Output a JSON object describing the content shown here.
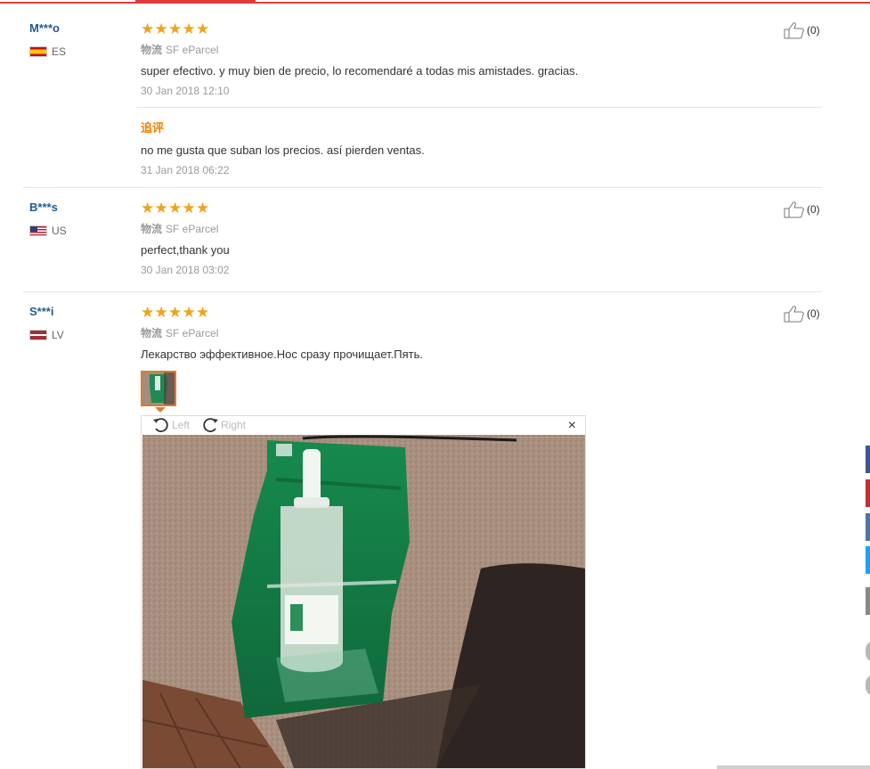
{
  "reviews": [
    {
      "user": "M***o",
      "country": "ES",
      "stars": [
        "★",
        "★",
        "★",
        "★",
        "★"
      ],
      "ship_label": "物流",
      "ship_method": "SF eParcel",
      "text": "super efectivo. y muy bien de precio, lo recomendaré a todas mis amistades. gracias.",
      "date": "30 Jan 2018 12:10",
      "like_count": "(0)",
      "followup": {
        "title": "追评",
        "text": "no me gusta que suban los precios. así pierden ventas.",
        "date": "31 Jan 2018 06:22"
      }
    },
    {
      "user": "B***s",
      "country": "US",
      "stars": [
        "★",
        "★",
        "★",
        "★",
        "★"
      ],
      "ship_label": "物流",
      "ship_method": "SF eParcel",
      "text": "perfect,thank you",
      "date": "30 Jan 2018 03:02",
      "like_count": "(0)"
    },
    {
      "user": "S***i",
      "country": "LV",
      "stars": [
        "★",
        "★",
        "★",
        "★",
        "★"
      ],
      "ship_label": "物流",
      "ship_method": "SF eParcel",
      "text": "Лекарство эффективное.Нос сразу прочищает.Пять.",
      "date": "",
      "like_count": "(0)"
    }
  ],
  "viewer": {
    "rotate_left": "Left",
    "rotate_right": "Right",
    "close": "×"
  },
  "icons": {
    "like": "thumbs-up-icon",
    "rotate_left": "rotate-left-icon",
    "rotate_right": "rotate-right-icon"
  },
  "colors": {
    "accent": "#e4393c",
    "star": "#f0a31b",
    "username": "#1f5c94",
    "followup": "#f08200",
    "side_buttons": [
      "#3b5998",
      "#c4302b",
      "#4a76a8",
      "#1da1f2",
      "#888888"
    ]
  }
}
